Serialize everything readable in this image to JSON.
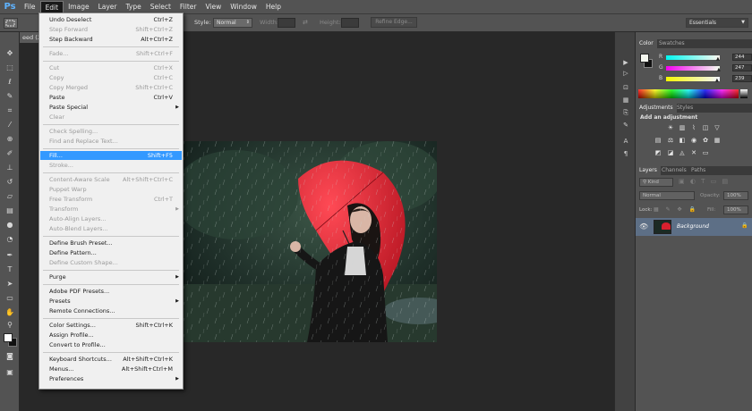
{
  "app": {
    "logo": "Ps"
  },
  "menubar": [
    "File",
    "Edit",
    "Image",
    "Layer",
    "Type",
    "Select",
    "Filter",
    "View",
    "Window",
    "Help"
  ],
  "active_menu": "Edit",
  "options": {
    "style_label": "Style:",
    "style_value": "Normal",
    "width_label": "Width:",
    "height_label": "Height:",
    "refine_edge": "Refine Edge...",
    "workspace": "Essentials"
  },
  "document": {
    "tab_label": "eed (2"
  },
  "edit_menu": [
    {
      "label": "Undo Deselect",
      "shortcut": "Ctrl+Z",
      "enabled": true
    },
    {
      "label": "Step Forward",
      "shortcut": "Shift+Ctrl+Z",
      "enabled": false
    },
    {
      "label": "Step Backward",
      "shortcut": "Alt+Ctrl+Z",
      "enabled": true
    },
    {
      "sep": true
    },
    {
      "label": "Fade...",
      "shortcut": "Shift+Ctrl+F",
      "enabled": false
    },
    {
      "sep": true
    },
    {
      "label": "Cut",
      "shortcut": "Ctrl+X",
      "enabled": false
    },
    {
      "label": "Copy",
      "shortcut": "Ctrl+C",
      "enabled": false
    },
    {
      "label": "Copy Merged",
      "shortcut": "Shift+Ctrl+C",
      "enabled": false
    },
    {
      "label": "Paste",
      "shortcut": "Ctrl+V",
      "enabled": true
    },
    {
      "label": "Paste Special",
      "shortcut": "",
      "enabled": true,
      "submenu": true
    },
    {
      "label": "Clear",
      "shortcut": "",
      "enabled": false
    },
    {
      "sep": true
    },
    {
      "label": "Check Spelling...",
      "shortcut": "",
      "enabled": false
    },
    {
      "label": "Find and Replace Text...",
      "shortcut": "",
      "enabled": false
    },
    {
      "sep": true
    },
    {
      "label": "Fill...",
      "shortcut": "Shift+F5",
      "enabled": true,
      "highlight": true
    },
    {
      "label": "Stroke...",
      "shortcut": "",
      "enabled": false
    },
    {
      "sep": true
    },
    {
      "label": "Content-Aware Scale",
      "shortcut": "Alt+Shift+Ctrl+C",
      "enabled": false
    },
    {
      "label": "Puppet Warp",
      "shortcut": "",
      "enabled": false
    },
    {
      "label": "Free Transform",
      "shortcut": "Ctrl+T",
      "enabled": false
    },
    {
      "label": "Transform",
      "shortcut": "",
      "enabled": false,
      "submenu": true
    },
    {
      "label": "Auto-Align Layers...",
      "shortcut": "",
      "enabled": false
    },
    {
      "label": "Auto-Blend Layers...",
      "shortcut": "",
      "enabled": false
    },
    {
      "sep": true
    },
    {
      "label": "Define Brush Preset...",
      "shortcut": "",
      "enabled": true
    },
    {
      "label": "Define Pattern...",
      "shortcut": "",
      "enabled": true
    },
    {
      "label": "Define Custom Shape...",
      "shortcut": "",
      "enabled": false
    },
    {
      "sep": true
    },
    {
      "label": "Purge",
      "shortcut": "",
      "enabled": true,
      "submenu": true
    },
    {
      "sep": true
    },
    {
      "label": "Adobe PDF Presets...",
      "shortcut": "",
      "enabled": true
    },
    {
      "label": "Presets",
      "shortcut": "",
      "enabled": true,
      "submenu": true
    },
    {
      "label": "Remote Connections...",
      "shortcut": "",
      "enabled": true
    },
    {
      "sep": true
    },
    {
      "label": "Color Settings...",
      "shortcut": "Shift+Ctrl+K",
      "enabled": true
    },
    {
      "label": "Assign Profile...",
      "shortcut": "",
      "enabled": true
    },
    {
      "label": "Convert to Profile...",
      "shortcut": "",
      "enabled": true
    },
    {
      "sep": true
    },
    {
      "label": "Keyboard Shortcuts...",
      "shortcut": "Alt+Shift+Ctrl+K",
      "enabled": true
    },
    {
      "label": "Menus...",
      "shortcut": "Alt+Shift+Ctrl+M",
      "enabled": true
    },
    {
      "label": "Preferences",
      "shortcut": "",
      "enabled": true,
      "submenu": true
    }
  ],
  "color_panel": {
    "tabs": [
      "Color",
      "Swatches"
    ],
    "r_label": "R",
    "r": "244",
    "g_label": "G",
    "g": "247",
    "b_label": "B",
    "b": "239"
  },
  "adjustments_panel": {
    "tabs": [
      "Adjustments",
      "Styles"
    ],
    "heading": "Add an adjustment"
  },
  "layers_panel": {
    "tabs": [
      "Layers",
      "Channels",
      "Paths"
    ],
    "kind": "Kind",
    "blend_mode": "Normal",
    "opacity_label": "Opacity:",
    "opacity": "100%",
    "lock_label": "Lock:",
    "fill_label": "Fill:",
    "fill": "100%",
    "layer_name": "Background"
  },
  "colors": {
    "accent": "#3399ff",
    "panel": "#535353",
    "canvas_bg": "#282828",
    "umbrella": "#d8202e"
  }
}
